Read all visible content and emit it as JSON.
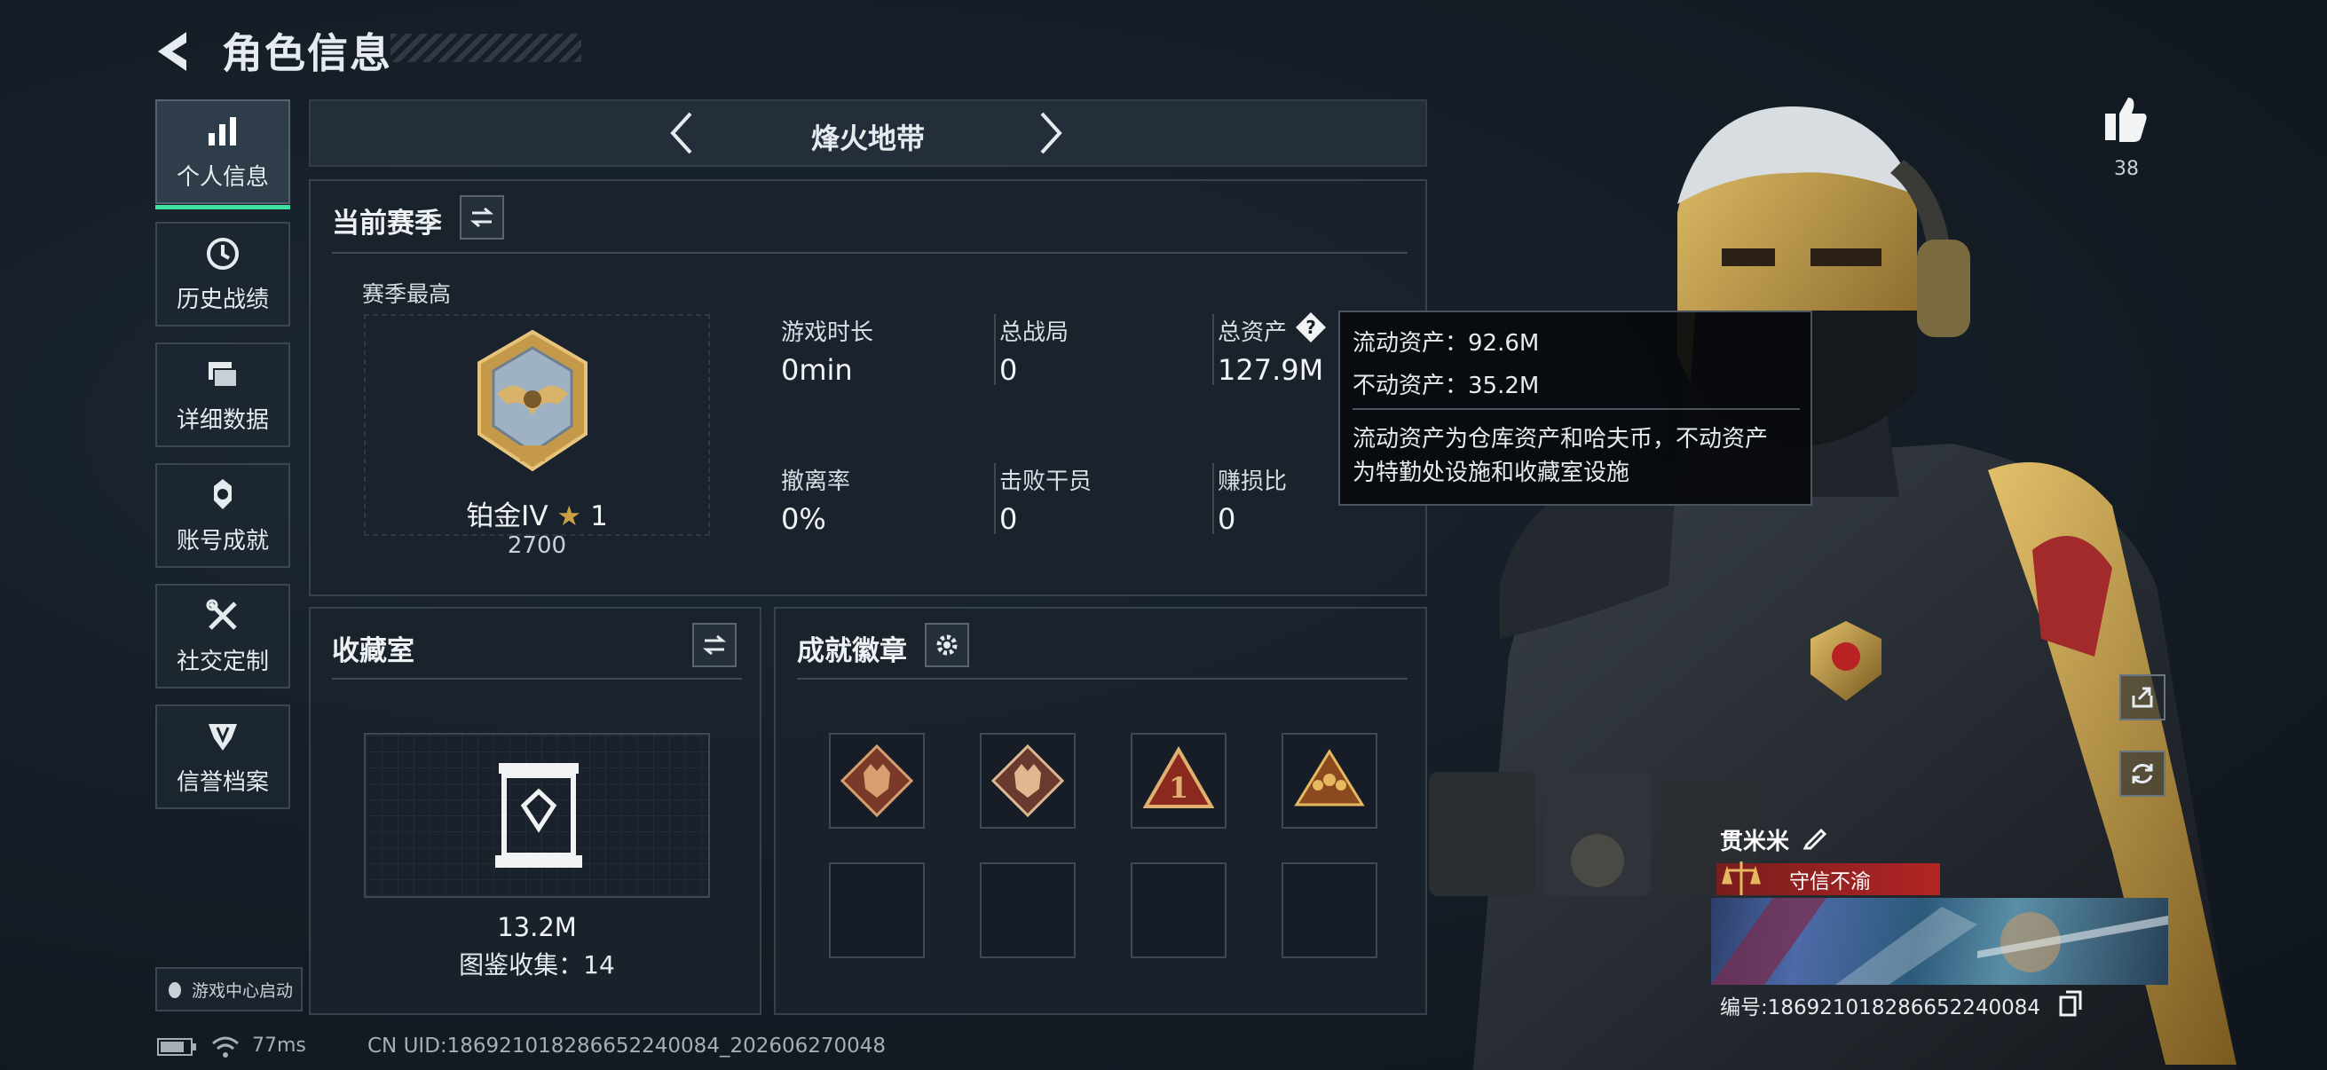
{
  "header": {
    "title": "角色信息"
  },
  "nav": [
    {
      "label": "个人信息",
      "icon": "bar-chart-icon",
      "active": true
    },
    {
      "label": "历史战绩",
      "icon": "clock-icon"
    },
    {
      "label": "详细数据",
      "icon": "folders-icon"
    },
    {
      "label": "账号成就",
      "icon": "medal-icon"
    },
    {
      "label": "社交定制",
      "icon": "wrench-screwdriver-icon"
    },
    {
      "label": "信誉档案",
      "icon": "shield-badge-icon"
    }
  ],
  "game_center_button": "游戏中心启动",
  "mode": {
    "name": "烽火地带"
  },
  "season": {
    "title": "当前赛季",
    "best_label": "赛季最高",
    "rank_name": "铂金IV",
    "rank_stars": "1",
    "rank_points": "2700",
    "stats": [
      {
        "label": "游戏时长",
        "value": "0min"
      },
      {
        "label": "总战局",
        "value": "0"
      },
      {
        "label": "总资产",
        "value": "127.9M"
      },
      {
        "label": "撤离率",
        "value": "0%"
      },
      {
        "label": "击败干员",
        "value": "0"
      },
      {
        "label": "赚损比",
        "value": "0"
      }
    ]
  },
  "tooltip": {
    "liquid": "流动资产：92.6M",
    "fixed": "不动资产：35.2M",
    "note_line1": "流动资产为仓库资产和哈夫币，不动资产",
    "note_line2": "为特勤处设施和收藏室设施"
  },
  "collection": {
    "title": "收藏室",
    "value": "13.2M",
    "catalog": "图鉴收集：14"
  },
  "achievements": {
    "title": "成就徽章",
    "badges": [
      "wolf-badge-icon",
      "wolf-badge-icon",
      "rank-one-badge-icon",
      "team-badge-icon",
      "",
      "",
      "",
      ""
    ]
  },
  "likes": {
    "count": "38"
  },
  "player": {
    "name": "贯米米",
    "credit": "守信不渝",
    "number": "编号:186921018286652240084"
  },
  "footer": {
    "ping": "77ms",
    "uid": "CN UID:186921018286652240084_202606270048"
  },
  "colors": {
    "accent": "#3fe0a0",
    "credit": "#b22525",
    "gold": "#c9a046"
  }
}
